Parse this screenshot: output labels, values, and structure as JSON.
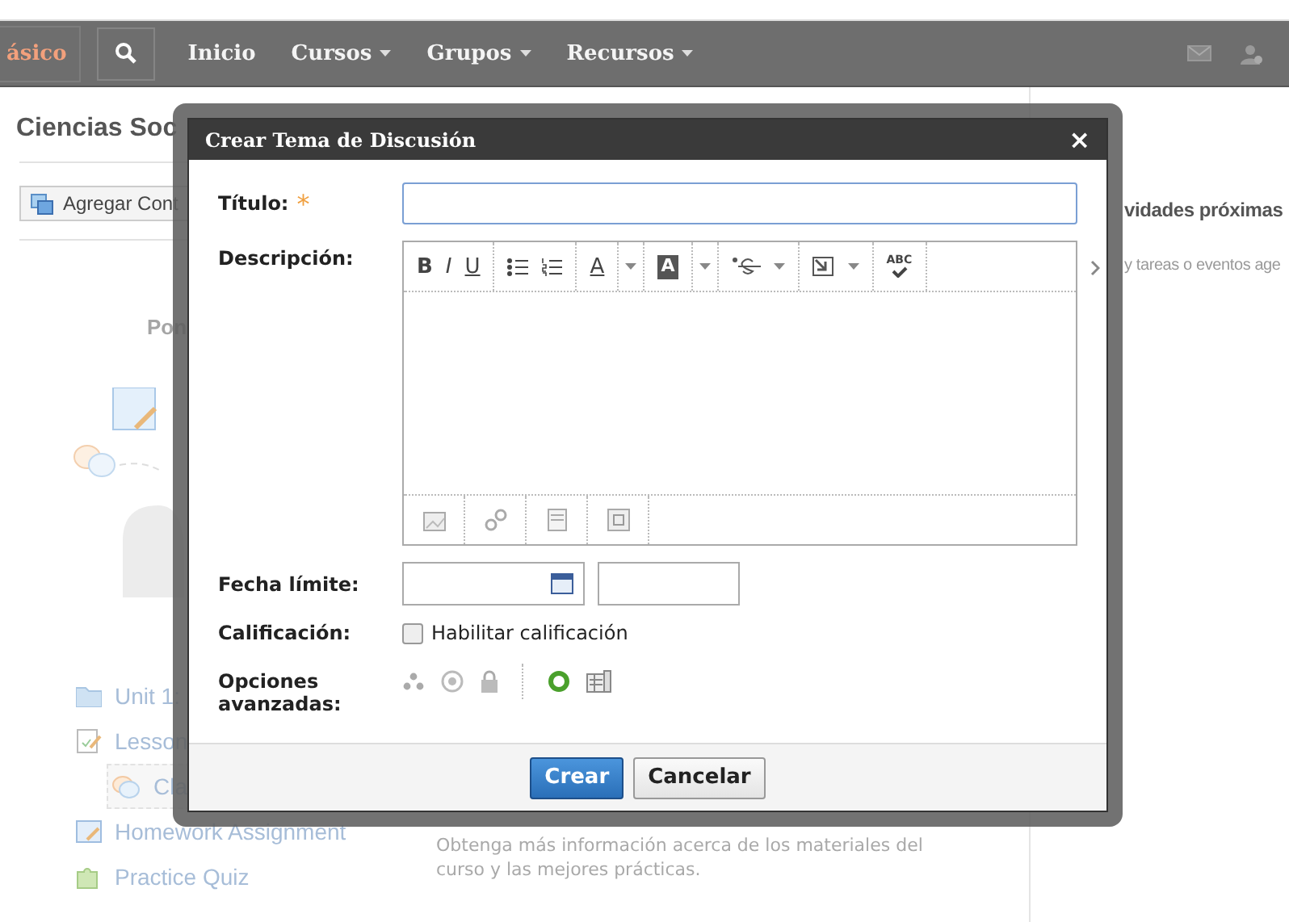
{
  "navbar": {
    "brand": "ásico",
    "menu": [
      {
        "label": "Inicio",
        "dropdown": false
      },
      {
        "label": "Cursos",
        "dropdown": true
      },
      {
        "label": "Grupos",
        "dropdown": true
      },
      {
        "label": "Recursos",
        "dropdown": true
      }
    ]
  },
  "page": {
    "title": "Ciencias Soc",
    "add_button": "Agregar Cont",
    "hint": "Pon",
    "items": [
      {
        "label": "Unit 1:",
        "kind": "folder",
        "selected": false
      },
      {
        "label": "Lesson",
        "kind": "lesson",
        "selected": false
      },
      {
        "label": "Cla",
        "kind": "discussion",
        "selected": true
      },
      {
        "label": "Homework Assignment",
        "kind": "assignment",
        "selected": false
      },
      {
        "label": "Practice Quiz",
        "kind": "quiz",
        "selected": false
      }
    ],
    "info": "Obtenga más información acerca de los materiales del curso y las mejores prácticas."
  },
  "sidebar": {
    "heading": "vidades próximas",
    "text": "y tareas o eventos age"
  },
  "dialog": {
    "title": "Crear Tema de Discusión",
    "close": "×",
    "title_label": "Título:",
    "required_mark": "*",
    "description_label": "Descripción:",
    "format_buttons": [
      "B",
      "I",
      "U"
    ],
    "color_buttons": [
      "A",
      "A"
    ],
    "spell_label": "ABC",
    "due_label": "Fecha límite:",
    "grading_label": "Calificación:",
    "grading_option": {
      "label": "Habilitar calificación",
      "checked": false
    },
    "advanced_label": "Opciones avanzadas:",
    "buttons": [
      {
        "label": "Crear",
        "kind": "primary"
      },
      {
        "label": "Cancelar",
        "kind": "secondary"
      }
    ]
  }
}
